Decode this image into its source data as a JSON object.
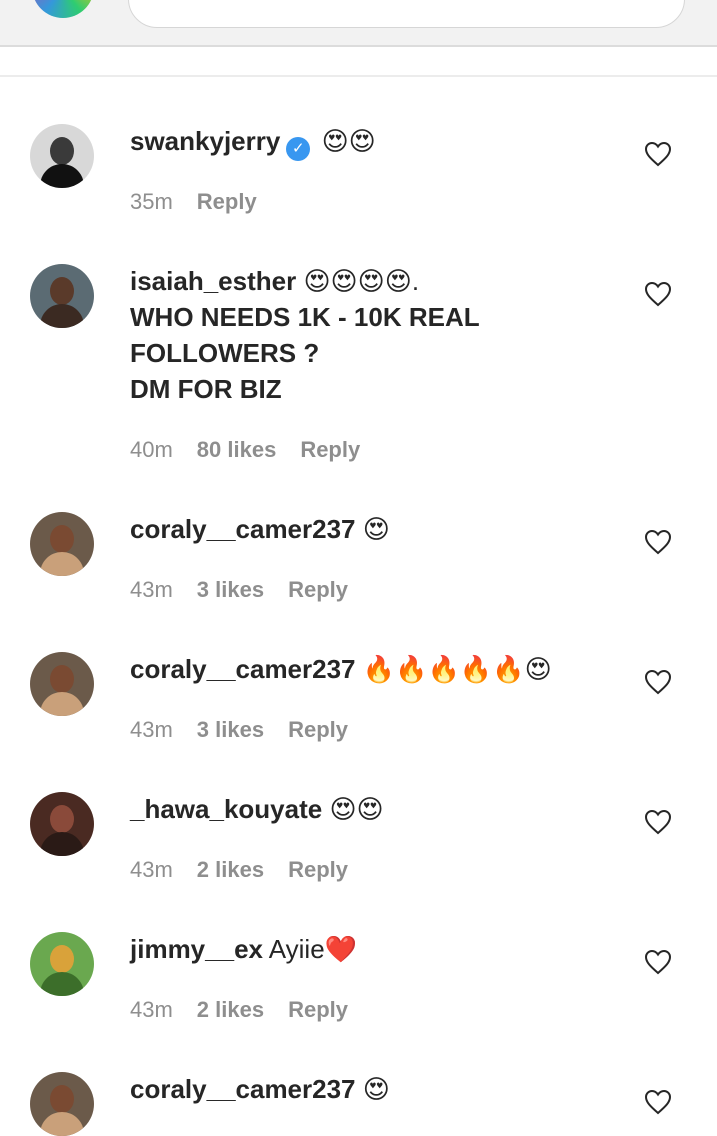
{
  "comments": [
    {
      "username": "swankyjerry",
      "verified": true,
      "text": "😍😍",
      "time": "35m",
      "likes": "",
      "reply_label": "Reply"
    },
    {
      "username": "isaiah_esther",
      "verified": false,
      "text": "😍😍😍😍.",
      "line2": "WHO NEEDS 1K - 10K REAL",
      "line3": "FOLLOWERS ?",
      "line4": "DM FOR BIZ",
      "time": "40m",
      "likes": "80 likes",
      "reply_label": "Reply"
    },
    {
      "username": "coraly__camer237",
      "verified": false,
      "text": "😍",
      "time": "43m",
      "likes": "3 likes",
      "reply_label": "Reply"
    },
    {
      "username": "coraly__camer237",
      "verified": false,
      "text": "🔥🔥🔥🔥🔥😍",
      "time": "43m",
      "likes": "3 likes",
      "reply_label": "Reply"
    },
    {
      "username": "_hawa_kouyate",
      "verified": false,
      "text": "😍😍",
      "time": "43m",
      "likes": "2 likes",
      "reply_label": "Reply"
    },
    {
      "username": "jimmy__ex",
      "verified": false,
      "text": "Ayiie❤️",
      "time": "43m",
      "likes": "2 likes",
      "reply_label": "Reply"
    },
    {
      "username": "coraly__camer237",
      "verified": false,
      "text": "😍",
      "time": "",
      "likes": "",
      "reply_label": ""
    }
  ],
  "icons": {
    "like": "heart-outline-icon",
    "verified": "verified-badge-icon"
  },
  "colors": {
    "text": "#262626",
    "meta": "#8e8e8e",
    "verified": "#3897f0"
  }
}
